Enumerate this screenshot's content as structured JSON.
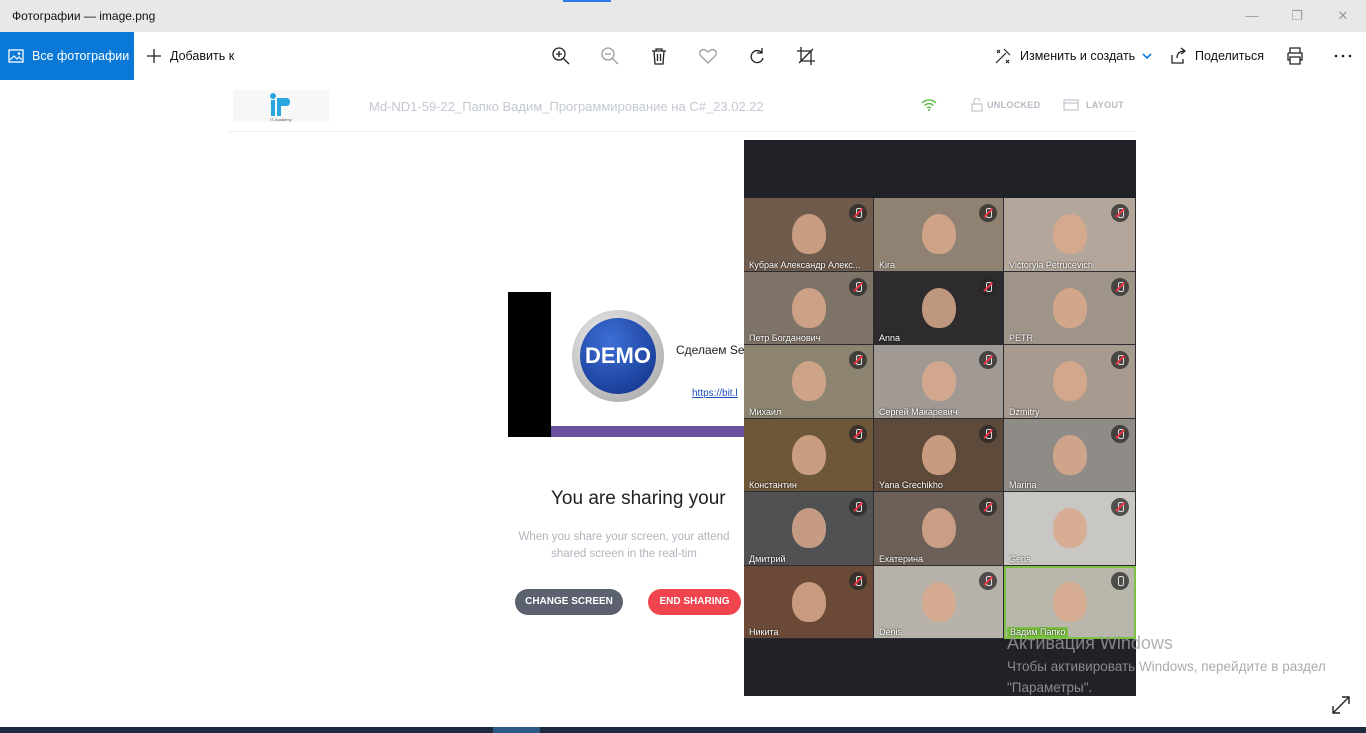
{
  "window": {
    "title": "Фотографии — image.png"
  },
  "toolbar": {
    "all_photos": "Все фотографии",
    "add_to": "Добавить к",
    "edit_create": "Изменить и создать",
    "share": "Поделиться"
  },
  "meeting": {
    "title": "Md-ND1-59-22_Папко Вадим_Программирование на C#_23.02.22",
    "unlocked": "UNLOCKED",
    "layout": "LAYOUT",
    "logo_text": "IT-Academy"
  },
  "slide": {
    "demo_label": "DEMO",
    "text": "Сделаем Se",
    "link": "https://bit.l"
  },
  "sharing": {
    "heading": "You are sharing your",
    "desc_line1": "When you share your screen, your attend",
    "desc_line2": "shared screen in the real-tim",
    "change_screen": "CHANGE SCREEN",
    "end_sharing": "END SHARING"
  },
  "participants": [
    {
      "name": "Кубрак Александр Алекс...",
      "muted": true,
      "bg": "#6f5b4c"
    },
    {
      "name": "Kira",
      "muted": true,
      "bg": "#8f8272"
    },
    {
      "name": "Victoryia Petrucevich",
      "muted": true,
      "bg": "#b2a79a"
    },
    {
      "name": "Петр Богданович",
      "muted": true,
      "bg": "#7e7367"
    },
    {
      "name": "Anna",
      "muted": true,
      "bg": "#2d2b2e"
    },
    {
      "name": "PETR",
      "muted": true,
      "bg": "#9f9488"
    },
    {
      "name": "Михаил",
      "muted": true,
      "bg": "#8c8470"
    },
    {
      "name": "Сергей Макаревич",
      "muted": true,
      "bg": "#a19a94"
    },
    {
      "name": "Dzmitry",
      "muted": true,
      "bg": "#a79a8f"
    },
    {
      "name": "Константин",
      "muted": true,
      "bg": "#6e5639"
    },
    {
      "name": "Yana Grechikho",
      "muted": true,
      "bg": "#5e4a3a"
    },
    {
      "name": "Marina",
      "muted": true,
      "bg": "#8f8b86"
    },
    {
      "name": "Дмитрий",
      "muted": true,
      "bg": "#4f5153"
    },
    {
      "name": "Екатерина",
      "muted": true,
      "bg": "#6d6058"
    },
    {
      "name": "Gena",
      "muted": true,
      "bg": "#c9c7c4"
    },
    {
      "name": "Никита",
      "muted": true,
      "bg": "#6a4a36"
    },
    {
      "name": "Denis",
      "muted": true,
      "bg": "#b6b2aa"
    },
    {
      "name": "Вадим Папко",
      "muted": false,
      "active": true,
      "bg": "#b9b7ab"
    }
  ],
  "watermark": {
    "line1": "Активация Windows",
    "line2": "Чтобы активировать Windows, перейдите в раздел \"Параметры\"."
  },
  "colors": {
    "accent": "#0a78d7",
    "active_speaker": "#7bc142",
    "end_button": "#f0454f"
  }
}
